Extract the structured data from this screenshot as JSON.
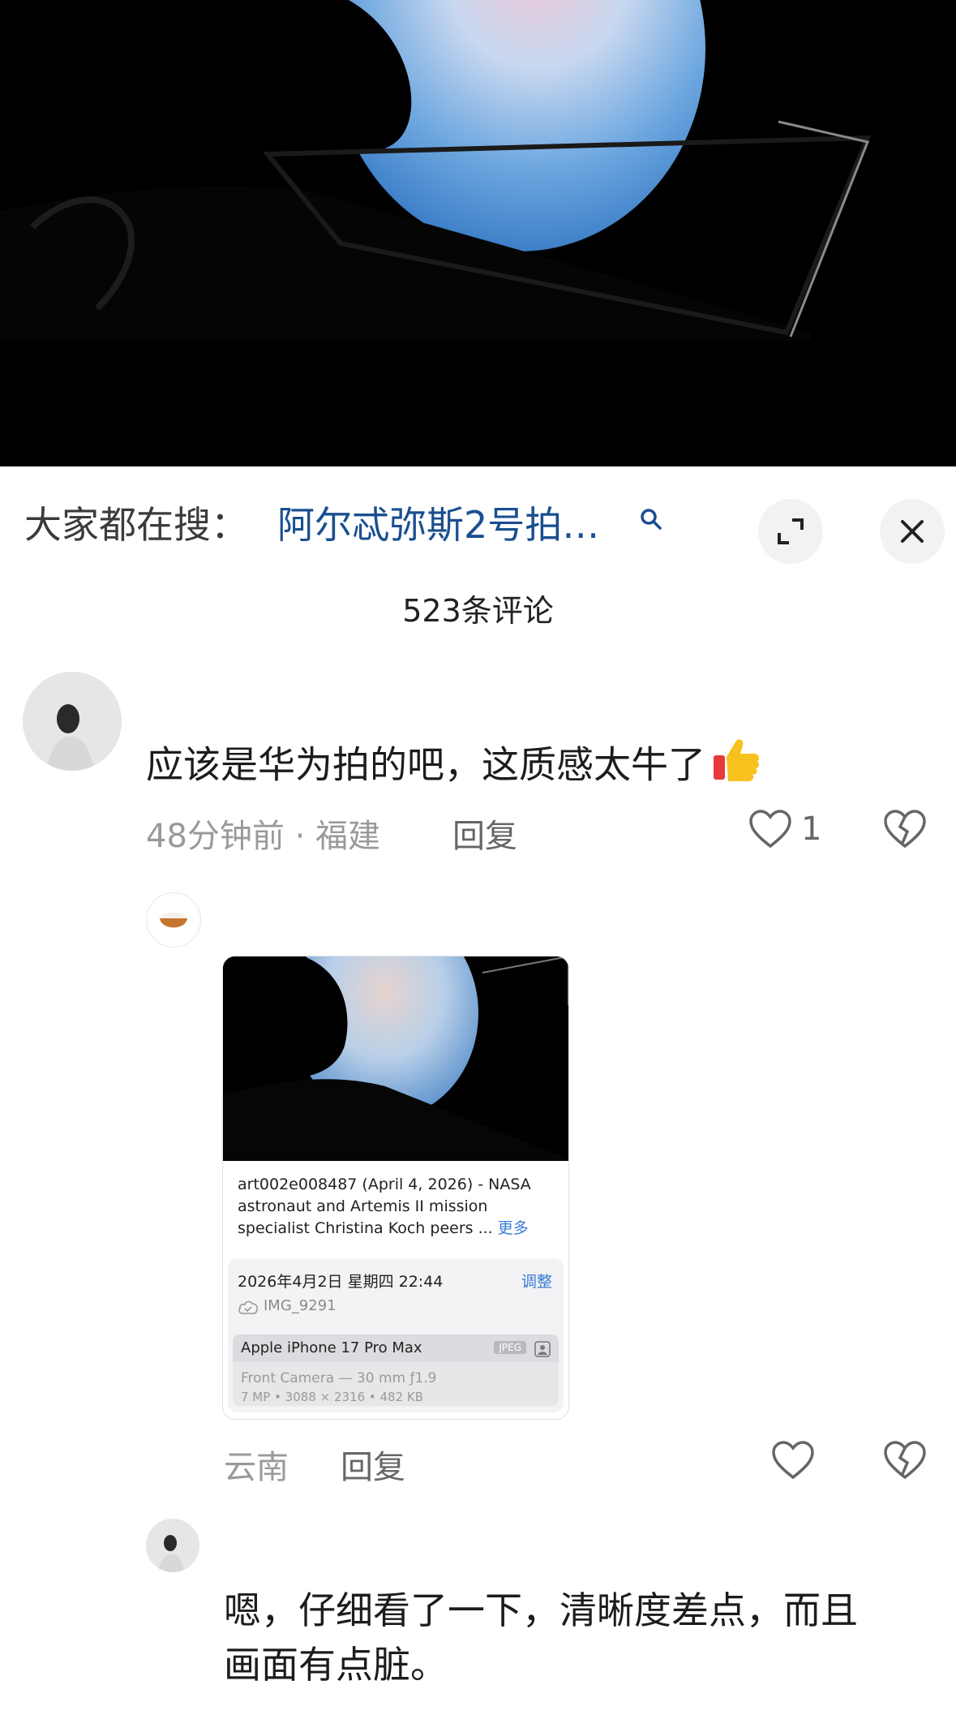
{
  "search": {
    "prefix": "大家都在搜：",
    "query": "阿尔忒弥斯2号拍…"
  },
  "comments_header": {
    "count_label": "523条评论"
  },
  "comment1": {
    "text": "应该是华为拍的吧，这质感太牛了",
    "time_location": "48分钟前 · 福建",
    "reply_label": "回复",
    "like_count": "1"
  },
  "reply1": {
    "card": {
      "caption": "art002e008487 (April 4, 2026) - NASA astronaut and Artemis II mission specialist Christina Koch peers ...",
      "more_label": "更多",
      "datetime": "2026年4月2日 星期四 22:44",
      "adjust_label": "调整",
      "filename": "IMG_9291",
      "device": "Apple iPhone 17 Pro Max",
      "format_badge": "JPEG",
      "camera_specs": "Front Camera — 30 mm ƒ1.9",
      "dimensions": "7 MP • 3088 × 2316 • 482 KB"
    },
    "location": "云南",
    "reply_label": "回复"
  },
  "reply2": {
    "text_line1": "嗯，仔细看了一下，清晰度差点，而且",
    "text_line2": "画面有点脏。"
  },
  "icons": {
    "search": "search-icon",
    "expand": "expand-icon",
    "close": "close-icon",
    "like": "heart-icon",
    "dislike": "broken-heart-icon",
    "thumbs_up": "thumbs-up-emoji"
  }
}
